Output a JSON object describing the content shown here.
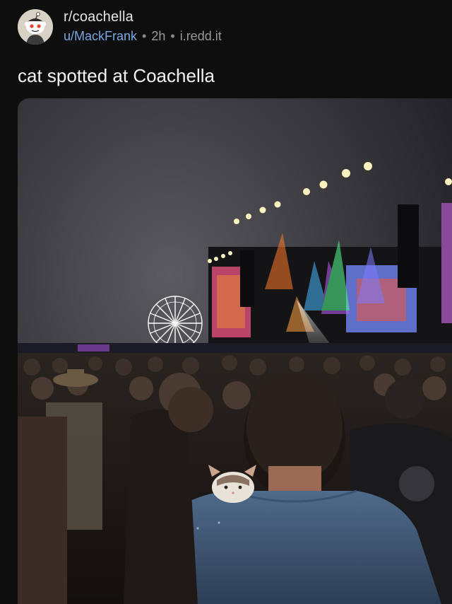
{
  "post": {
    "subreddit": "r/coachella",
    "author": "u/MackFrank",
    "separator": "•",
    "age": "2h",
    "domain": "i.redd.it",
    "title": "cat spotted at Coachella"
  },
  "icons": {
    "avatar": "reddit-snoo-avatar-icon"
  },
  "colors": {
    "background": "#0e0e0f",
    "author_link": "#7aa7e0",
    "meta_text": "#9a9a9a"
  }
}
